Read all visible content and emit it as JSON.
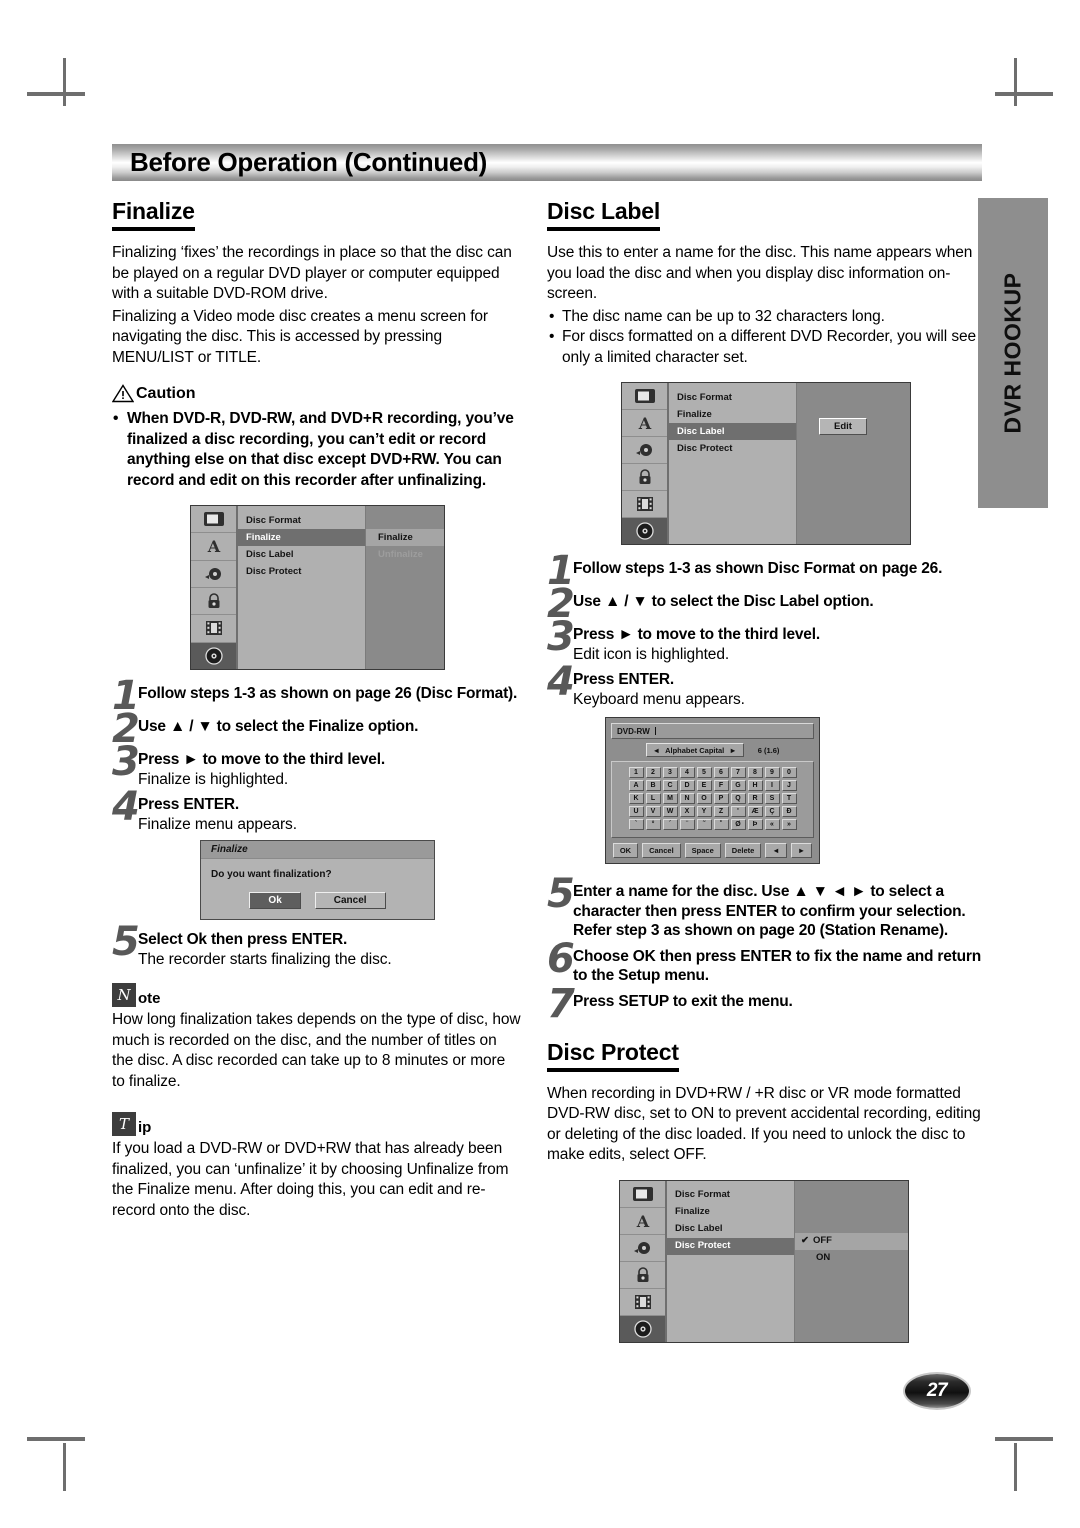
{
  "banner": {
    "title": "Before Operation (Continued)"
  },
  "side_tab": {
    "label": "DVR HOOKUP"
  },
  "page_number": "27",
  "left": {
    "finalize": {
      "heading": "Finalize",
      "paragraphs": [
        "Finalizing ‘fixes’ the recordings in place so that the disc can be played on a regular DVD player or computer equipped with a suitable DVD-ROM drive.",
        "Finalizing a Video mode disc creates a menu screen for navigating the disc. This is accessed by pressing MENU/LIST or TITLE."
      ],
      "caution_label": "Caution",
      "caution_items": [
        "When DVD-R, DVD-RW, and DVD+R recording, you’ve finalized a disc recording, you can’t edit or record anything else on that disc except DVD+RW. You can record and edit on this recorder after unfinalizing."
      ],
      "osd": {
        "menu_items": [
          {
            "label": "Disc Format",
            "selected": false
          },
          {
            "label": "Finalize",
            "selected": true
          },
          {
            "label": "Disc Label",
            "selected": false
          },
          {
            "label": "Disc Protect",
            "selected": false
          }
        ],
        "submenu_items": [
          {
            "label": "Finalize",
            "selected": true,
            "dimmed": false
          },
          {
            "label": "Unfinalize",
            "selected": false,
            "dimmed": true
          }
        ],
        "sidebar_icons": [
          "tv-icon",
          "letter-a-icon",
          "audio-disc-icon",
          "lock-icon",
          "film-strip-icon",
          "disc-icon"
        ],
        "selected_sidebar_index": 5
      },
      "steps": [
        {
          "num": "1",
          "bold": "Follow steps 1-3 as shown on page 26 (Disc Format).",
          "normal": ""
        },
        {
          "num": "2",
          "bold": "Use ▲ / ▼ to select the Finalize option.",
          "normal": ""
        },
        {
          "num": "3",
          "bold": "Press ► to move to the third level.",
          "normal": "Finalize is highlighted."
        },
        {
          "num": "4",
          "bold": "Press ENTER.",
          "normal": "Finalize menu appears."
        }
      ],
      "dialog": {
        "title": "Finalize",
        "message": "Do you want finalization?",
        "buttons": [
          {
            "label": "Ok",
            "selected": true
          },
          {
            "label": "Cancel",
            "selected": false
          }
        ]
      },
      "step5": {
        "num": "5",
        "bold": "Select Ok then press ENTER.",
        "normal": "The recorder starts finalizing the disc."
      },
      "note": {
        "badge": "N",
        "word": "ote",
        "text": "How long finalization takes depends on the type of disc, how much is recorded on the disc, and the number of titles on the disc. A disc recorded can take up to 8 minutes or more to finalize."
      },
      "tip": {
        "badge": "T",
        "word": "ip",
        "text": "If you load a DVD-RW or DVD+RW that has already been finalized, you can ‘unfinalize’ it by choosing Unfinalize from the Finalize menu. After doing this, you can edit and re-record onto the disc."
      }
    }
  },
  "right": {
    "disc_label": {
      "heading": "Disc Label",
      "paragraphs": [
        "Use this to enter a name for the disc. This name appears when you load the disc and when you display disc information on-screen."
      ],
      "bullets": [
        "The disc name can be up to 32 characters long.",
        "For discs formatted on a different DVD Recorder, you will see only a limited character set."
      ],
      "osd": {
        "menu_items": [
          {
            "label": "Disc Format",
            "selected": false
          },
          {
            "label": "Finalize",
            "selected": false
          },
          {
            "label": "Disc Label",
            "selected": true
          },
          {
            "label": "Disc Protect",
            "selected": false
          }
        ],
        "edit_button": "Edit",
        "sidebar_icons": [
          "tv-icon",
          "letter-a-icon",
          "audio-disc-icon",
          "lock-icon",
          "film-strip-icon",
          "disc-icon"
        ],
        "selected_sidebar_index": 5
      },
      "steps": [
        {
          "num": "1",
          "bold": "Follow steps 1-3 as shown Disc Format on page 26.",
          "normal": ""
        },
        {
          "num": "2",
          "bold": "Use ▲ / ▼ to select the Disc Label option.",
          "normal": ""
        },
        {
          "num": "3",
          "bold": "Press ► to move to the third level.",
          "normal": "Edit icon is highlighted."
        },
        {
          "num": "4",
          "bold": "Press ENTER.",
          "normal": "Keyboard menu appears."
        }
      ],
      "keyboard": {
        "field_value": "DVD-RW",
        "mode_label": "Alphabet Capital",
        "counter": "6 (1.6)",
        "rows": [
          [
            "1",
            "2",
            "3",
            "4",
            "5",
            "6",
            "7",
            "8",
            "9",
            "0"
          ],
          [
            "A",
            "B",
            "C",
            "D",
            "E",
            "F",
            "G",
            "H",
            "I",
            "J"
          ],
          [
            "K",
            "L",
            "M",
            "N",
            "O",
            "P",
            "Q",
            "R",
            "S",
            "T"
          ],
          [
            "U",
            "V",
            "W",
            "X",
            "Y",
            "Z",
            "'",
            "Æ",
            "Ç",
            "Ð"
          ],
          [
            "`",
            "°",
            "´",
            "¨",
            "˜",
            "˚",
            "Ø",
            "Þ",
            "«",
            "»"
          ]
        ],
        "footer": [
          "OK",
          "Cancel",
          "Space",
          "Delete",
          "◄",
          "►"
        ]
      },
      "steps2": [
        {
          "num": "5",
          "bold": "Enter a name for the disc. Use ▲ ▼ ◄ ► to select a character then press ENTER to confirm your selection. Refer step 3 as shown on page 20 (Station Rename).",
          "normal": ""
        },
        {
          "num": "6",
          "bold": "Choose OK then press ENTER to fix the name and return to the Setup menu.",
          "normal": ""
        },
        {
          "num": "7",
          "bold": "Press SETUP to exit the menu.",
          "normal": ""
        }
      ]
    },
    "disc_protect": {
      "heading": "Disc Protect",
      "paragraphs": [
        "When recording in DVD+RW / +R disc or VR mode formatted DVD-RW disc, set to ON to prevent accidental recording, editing or deleting of the disc loaded. If you need to unlock the disc to make edits, select OFF."
      ],
      "osd": {
        "menu_items": [
          {
            "label": "Disc Format",
            "selected": false
          },
          {
            "label": "Finalize",
            "selected": false
          },
          {
            "label": "Disc Label",
            "selected": false
          },
          {
            "label": "Disc Protect",
            "selected": true
          }
        ],
        "submenu_items": [
          {
            "label": "OFF",
            "selected": true,
            "checked": true
          },
          {
            "label": "ON",
            "selected": false,
            "checked": false
          }
        ],
        "sidebar_icons": [
          "tv-icon",
          "letter-a-icon",
          "audio-disc-icon",
          "lock-icon",
          "film-strip-icon",
          "disc-icon"
        ],
        "selected_sidebar_index": 5
      }
    }
  }
}
